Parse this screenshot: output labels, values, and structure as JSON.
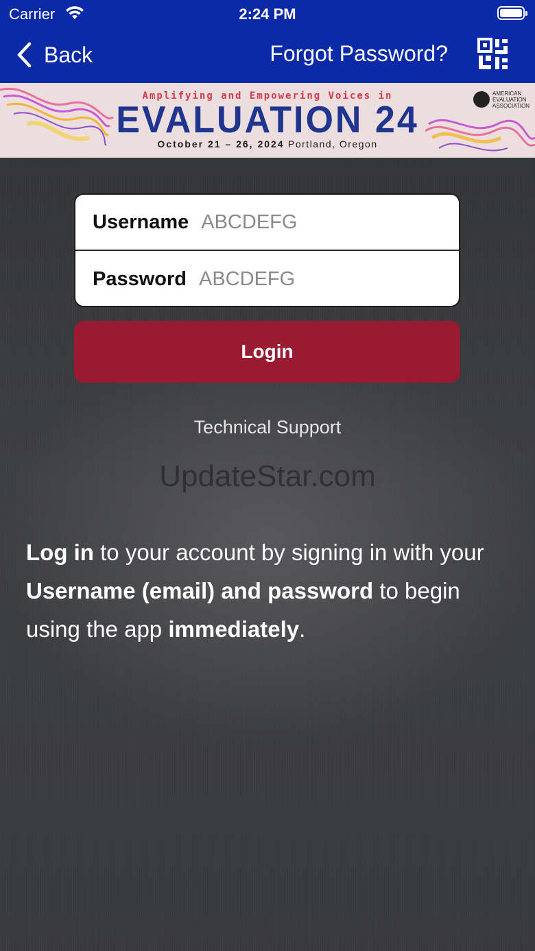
{
  "status_bar": {
    "carrier": "Carrier",
    "time": "2:24 PM"
  },
  "nav": {
    "back_label": "Back",
    "forgot_label": "Forgot Password?",
    "qr_icon": "qr-code-icon"
  },
  "banner": {
    "tagline": "Amplifying and Empowering Voices in",
    "title": "EVALUATION 24",
    "dates": "October 21 – 26, 2024",
    "location": "Portland, Oregon",
    "org_line1": "AMERICAN",
    "org_line2": "EVALUATION",
    "org_line3": "ASSOCIATION"
  },
  "form": {
    "username_label": "Username",
    "username_placeholder": "ABCDEFG",
    "password_label": "Password",
    "password_placeholder": "ABCDEFG"
  },
  "login_label": "Login",
  "support_label": "Technical Support",
  "watermark": "UpdateStar.com",
  "info": {
    "p1_bold": "Log in",
    "p1_text": " to your account by signing in with your ",
    "p2_bold": "Username (email) and password",
    "p2_text": " to begin using the app ",
    "p3_bold": "immediately",
    "p3_text": "."
  },
  "colors": {
    "nav_bg": "#0a2aa8",
    "login_bg": "#9a1a31",
    "title_blue": "#1f3590",
    "tagline_red": "#d8384b"
  }
}
